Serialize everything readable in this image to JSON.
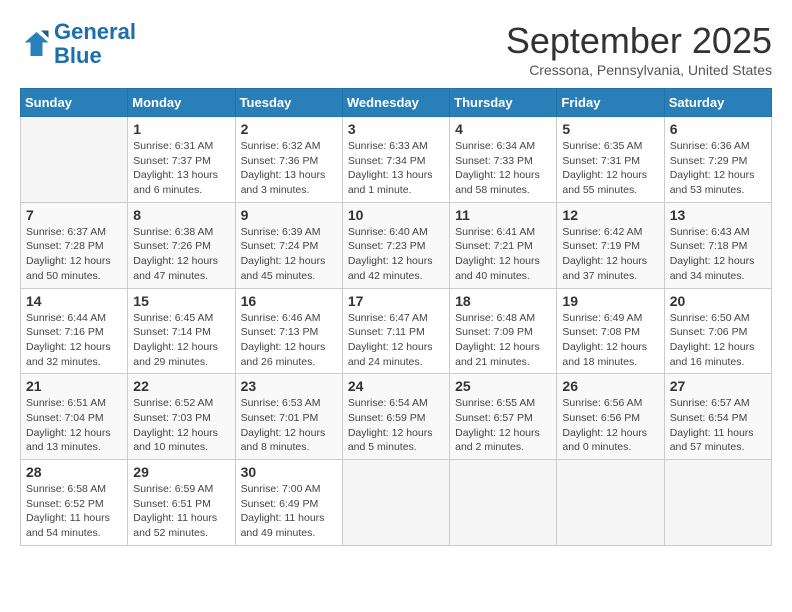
{
  "header": {
    "logo_line1": "General",
    "logo_line2": "Blue",
    "month": "September 2025",
    "location": "Cressona, Pennsylvania, United States"
  },
  "days_of_week": [
    "Sunday",
    "Monday",
    "Tuesday",
    "Wednesday",
    "Thursday",
    "Friday",
    "Saturday"
  ],
  "weeks": [
    [
      {
        "day": "",
        "info": ""
      },
      {
        "day": "1",
        "info": "Sunrise: 6:31 AM\nSunset: 7:37 PM\nDaylight: 13 hours\nand 6 minutes."
      },
      {
        "day": "2",
        "info": "Sunrise: 6:32 AM\nSunset: 7:36 PM\nDaylight: 13 hours\nand 3 minutes."
      },
      {
        "day": "3",
        "info": "Sunrise: 6:33 AM\nSunset: 7:34 PM\nDaylight: 13 hours\nand 1 minute."
      },
      {
        "day": "4",
        "info": "Sunrise: 6:34 AM\nSunset: 7:33 PM\nDaylight: 12 hours\nand 58 minutes."
      },
      {
        "day": "5",
        "info": "Sunrise: 6:35 AM\nSunset: 7:31 PM\nDaylight: 12 hours\nand 55 minutes."
      },
      {
        "day": "6",
        "info": "Sunrise: 6:36 AM\nSunset: 7:29 PM\nDaylight: 12 hours\nand 53 minutes."
      }
    ],
    [
      {
        "day": "7",
        "info": "Sunrise: 6:37 AM\nSunset: 7:28 PM\nDaylight: 12 hours\nand 50 minutes."
      },
      {
        "day": "8",
        "info": "Sunrise: 6:38 AM\nSunset: 7:26 PM\nDaylight: 12 hours\nand 47 minutes."
      },
      {
        "day": "9",
        "info": "Sunrise: 6:39 AM\nSunset: 7:24 PM\nDaylight: 12 hours\nand 45 minutes."
      },
      {
        "day": "10",
        "info": "Sunrise: 6:40 AM\nSunset: 7:23 PM\nDaylight: 12 hours\nand 42 minutes."
      },
      {
        "day": "11",
        "info": "Sunrise: 6:41 AM\nSunset: 7:21 PM\nDaylight: 12 hours\nand 40 minutes."
      },
      {
        "day": "12",
        "info": "Sunrise: 6:42 AM\nSunset: 7:19 PM\nDaylight: 12 hours\nand 37 minutes."
      },
      {
        "day": "13",
        "info": "Sunrise: 6:43 AM\nSunset: 7:18 PM\nDaylight: 12 hours\nand 34 minutes."
      }
    ],
    [
      {
        "day": "14",
        "info": "Sunrise: 6:44 AM\nSunset: 7:16 PM\nDaylight: 12 hours\nand 32 minutes."
      },
      {
        "day": "15",
        "info": "Sunrise: 6:45 AM\nSunset: 7:14 PM\nDaylight: 12 hours\nand 29 minutes."
      },
      {
        "day": "16",
        "info": "Sunrise: 6:46 AM\nSunset: 7:13 PM\nDaylight: 12 hours\nand 26 minutes."
      },
      {
        "day": "17",
        "info": "Sunrise: 6:47 AM\nSunset: 7:11 PM\nDaylight: 12 hours\nand 24 minutes."
      },
      {
        "day": "18",
        "info": "Sunrise: 6:48 AM\nSunset: 7:09 PM\nDaylight: 12 hours\nand 21 minutes."
      },
      {
        "day": "19",
        "info": "Sunrise: 6:49 AM\nSunset: 7:08 PM\nDaylight: 12 hours\nand 18 minutes."
      },
      {
        "day": "20",
        "info": "Sunrise: 6:50 AM\nSunset: 7:06 PM\nDaylight: 12 hours\nand 16 minutes."
      }
    ],
    [
      {
        "day": "21",
        "info": "Sunrise: 6:51 AM\nSunset: 7:04 PM\nDaylight: 12 hours\nand 13 minutes."
      },
      {
        "day": "22",
        "info": "Sunrise: 6:52 AM\nSunset: 7:03 PM\nDaylight: 12 hours\nand 10 minutes."
      },
      {
        "day": "23",
        "info": "Sunrise: 6:53 AM\nSunset: 7:01 PM\nDaylight: 12 hours\nand 8 minutes."
      },
      {
        "day": "24",
        "info": "Sunrise: 6:54 AM\nSunset: 6:59 PM\nDaylight: 12 hours\nand 5 minutes."
      },
      {
        "day": "25",
        "info": "Sunrise: 6:55 AM\nSunset: 6:57 PM\nDaylight: 12 hours\nand 2 minutes."
      },
      {
        "day": "26",
        "info": "Sunrise: 6:56 AM\nSunset: 6:56 PM\nDaylight: 12 hours\nand 0 minutes."
      },
      {
        "day": "27",
        "info": "Sunrise: 6:57 AM\nSunset: 6:54 PM\nDaylight: 11 hours\nand 57 minutes."
      }
    ],
    [
      {
        "day": "28",
        "info": "Sunrise: 6:58 AM\nSunset: 6:52 PM\nDaylight: 11 hours\nand 54 minutes."
      },
      {
        "day": "29",
        "info": "Sunrise: 6:59 AM\nSunset: 6:51 PM\nDaylight: 11 hours\nand 52 minutes."
      },
      {
        "day": "30",
        "info": "Sunrise: 7:00 AM\nSunset: 6:49 PM\nDaylight: 11 hours\nand 49 minutes."
      },
      {
        "day": "",
        "info": ""
      },
      {
        "day": "",
        "info": ""
      },
      {
        "day": "",
        "info": ""
      },
      {
        "day": "",
        "info": ""
      }
    ]
  ]
}
